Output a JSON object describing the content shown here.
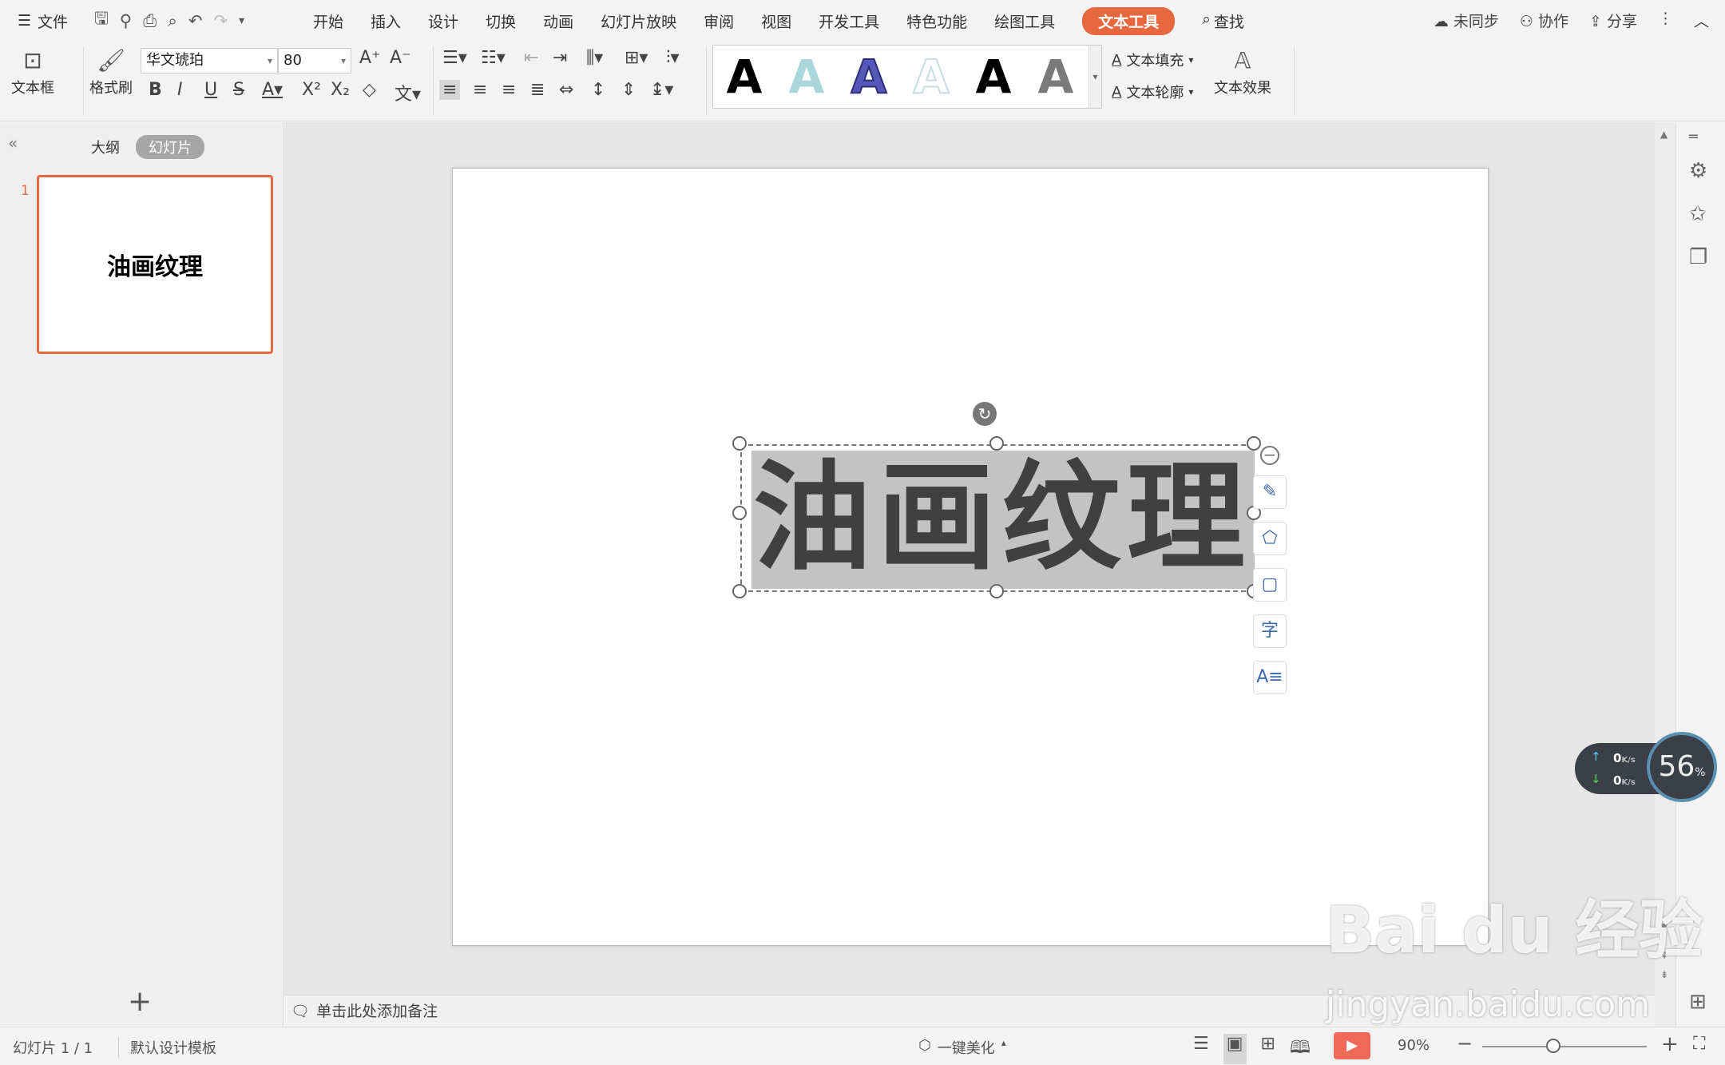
{
  "menu": {
    "file": "文件",
    "tabs": [
      "开始",
      "插入",
      "设计",
      "切换",
      "动画",
      "幻灯片放映",
      "审阅",
      "视图",
      "开发工具",
      "特色功能",
      "绘图工具",
      "文本工具"
    ],
    "active_tab": "文本工具",
    "search": "查找",
    "right": {
      "sync": "未同步",
      "collab": "协作",
      "share": "分享"
    }
  },
  "ribbon": {
    "textbox": "文本框",
    "format_painter": "格式刷",
    "font_name": "华文琥珀",
    "font_size": "80",
    "bold": "B",
    "italic": "I",
    "underline": "U",
    "strike": "S",
    "text_fill": "文本填充",
    "text_outline": "文本轮廓",
    "text_effect": "文本效果",
    "style_glyph": "A"
  },
  "left_panel": {
    "outline_tab": "大纲",
    "slides_tab": "幻灯片",
    "slide_number": "1",
    "thumb_text": "油画纹理"
  },
  "slide": {
    "title": "油画纹理"
  },
  "notes": {
    "placeholder": "单击此处添加备注"
  },
  "speed": {
    "up": "0",
    "down": "0",
    "unit": "K/s",
    "percent": "56",
    "percent_unit": "%"
  },
  "watermark": {
    "brand": "Bai du 经验",
    "url": "jingyan.baidu.com"
  },
  "status": {
    "slide_info": "幻灯片 1 / 1",
    "template": "默认设计模板",
    "beautify": "一键美化",
    "zoom": "90%"
  },
  "colors": {
    "accent": "#e7683f",
    "play": "#f06a5a"
  }
}
